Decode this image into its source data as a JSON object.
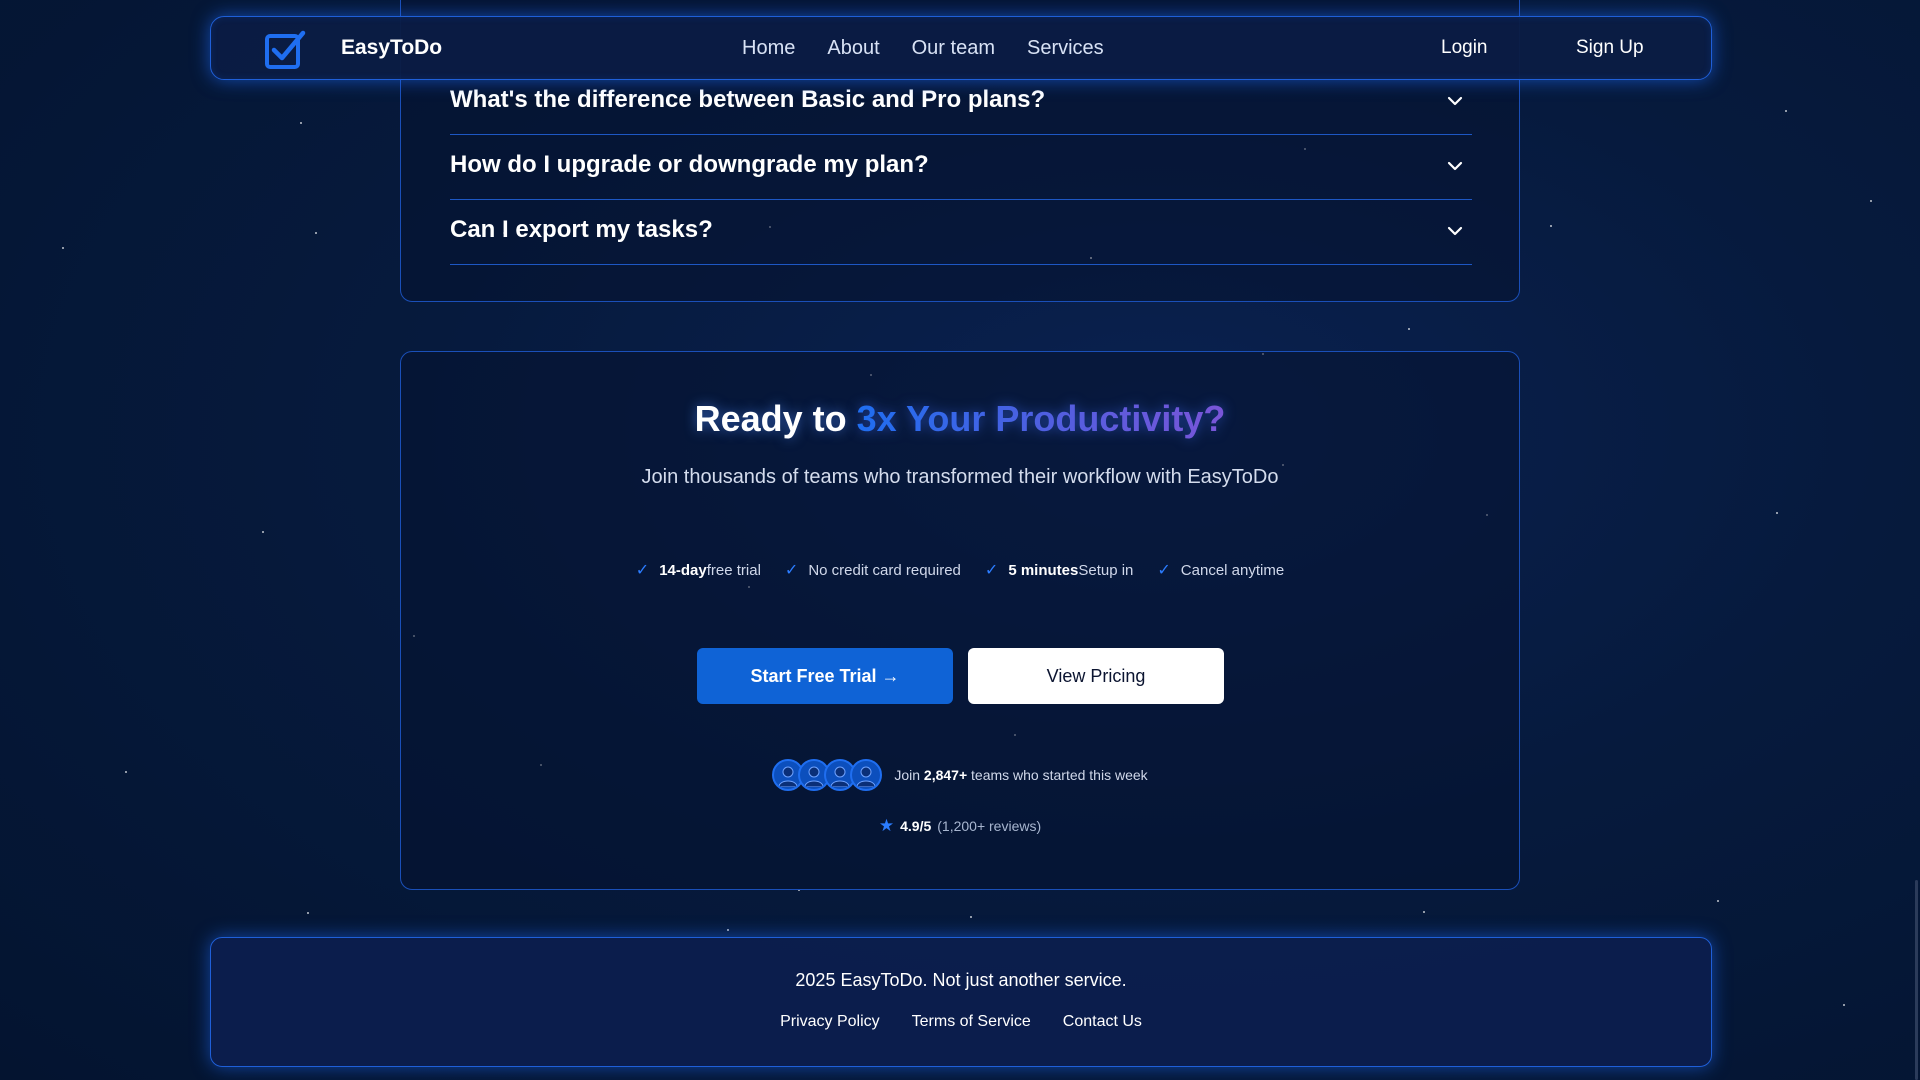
{
  "nav": {
    "brand": "EasyToDo",
    "logo_icon": "checkbox-check-icon",
    "links": [
      "Home",
      "About",
      "Our team",
      "Services"
    ],
    "login": "Login",
    "signup": "Sign Up"
  },
  "faq": {
    "items": [
      {
        "question": "What's the difference between Basic and Pro plans?",
        "icon": "chevron-down-icon"
      },
      {
        "question": "How do I upgrade or downgrade my plan?",
        "icon": "chevron-down-icon"
      },
      {
        "question": "Can I export my tasks?",
        "icon": "chevron-down-icon"
      }
    ]
  },
  "cta": {
    "title_prefix": "Ready to ",
    "title_highlight": "3x Your Productivity?",
    "subtitle": "Join thousands of teams who transformed their workflow with EasyToDo",
    "features": [
      {
        "bold": "14-day",
        "text": "free trial",
        "bold_first": true
      },
      {
        "bold": "",
        "text": "No credit card required",
        "bold_first": true
      },
      {
        "bold": "5 minutes",
        "text": "Setup in",
        "bold_first": true
      },
      {
        "bold": "",
        "text": "Cancel anytime",
        "bold_first": true
      }
    ],
    "check_glyph": "✓",
    "primary_button": "Start Free Trial →",
    "secondary_button": "View Pricing",
    "social": {
      "prefix": "Join ",
      "count": "2,847+",
      "suffix": " teams who started this week",
      "avatar_icon": "user-silhouette-icon"
    },
    "rating": {
      "icon": "star-icon",
      "score": "4.9/5",
      "count": "(1,200+ reviews)"
    }
  },
  "footer": {
    "copyright": "2025 EasyToDo. Not just another service.",
    "links": [
      "Privacy Policy",
      "Terms of Service",
      "Contact Us"
    ]
  },
  "colors": {
    "accent": "#1f6ef0",
    "background": "#061a3d",
    "card_border": "#1a4fb8",
    "primary_button": "#0f63d6"
  }
}
